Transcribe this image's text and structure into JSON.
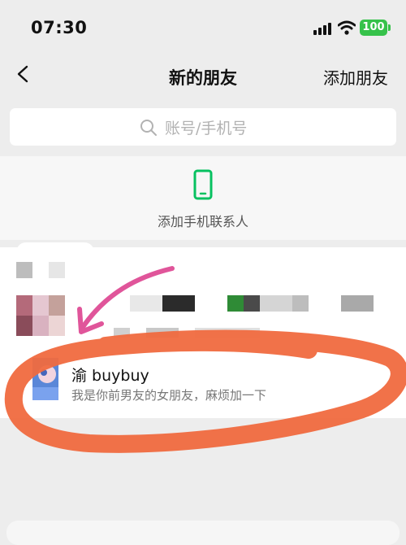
{
  "status_bar": {
    "time": "07:30",
    "battery": "100"
  },
  "nav": {
    "title": "新的朋友",
    "add_friend": "添加朋友"
  },
  "search": {
    "placeholder": "账号/手机号"
  },
  "add_phone_contacts": {
    "label": "添加手机联系人"
  },
  "friend_requests": [
    {
      "name": "渝 buybuy",
      "message": "我是你前男友的女朋友，麻烦加一下"
    }
  ],
  "colors": {
    "accent_green": "#07c160",
    "battery_green": "#36c24a",
    "annotation_orange": "#f06a3f",
    "annotation_pink": "#e0559a"
  }
}
